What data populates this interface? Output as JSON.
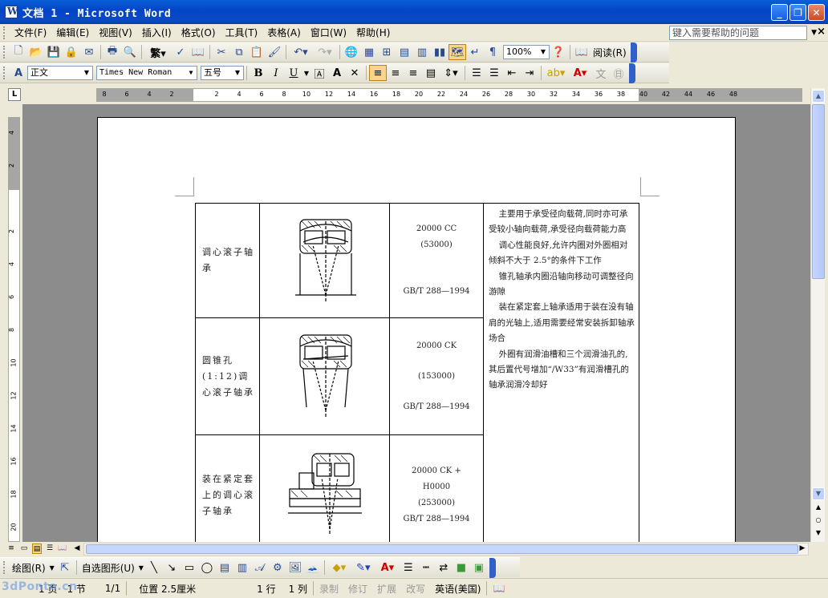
{
  "window": {
    "title": "文档 1 - Microsoft Word"
  },
  "menu": {
    "items": [
      "文件(F)",
      "编辑(E)",
      "视图(V)",
      "插入(I)",
      "格式(O)",
      "工具(T)",
      "表格(A)",
      "窗口(W)",
      "帮助(H)"
    ],
    "help_placeholder": "键入需要帮助的问题"
  },
  "standard_toolbar": {
    "zoom": "100%",
    "read_label": "阅读(R)"
  },
  "formatting_toolbar": {
    "style": "正文",
    "font": "Times New Roman",
    "size": "五号"
  },
  "ruler": {
    "h_ticks": [
      "8",
      "6",
      "4",
      "2",
      "2",
      "4",
      "6",
      "8",
      "10",
      "12",
      "14",
      "16",
      "18",
      "20",
      "22",
      "24",
      "26",
      "28",
      "30",
      "32",
      "34",
      "36",
      "38",
      "40",
      "42",
      "44",
      "46",
      "48"
    ],
    "v_ticks": [
      "4",
      "2",
      "2",
      "4",
      "6",
      "8",
      "10",
      "12",
      "14",
      "16",
      "18",
      "20"
    ]
  },
  "table": {
    "rows": [
      {
        "name": "调心滚子轴承",
        "code": "20000 CC",
        "code2": "(53000)",
        "standard": "GB/T 288—1994"
      },
      {
        "name": "圆锥孔(1:12)调心滚子轴承",
        "code": "20000 CK",
        "code2": "(153000)",
        "standard": "GB/T 288—1994"
      },
      {
        "name": "装在紧定套上的调心滚子轴承",
        "code": "20000 CK +",
        "code1b": "H0000",
        "code2": "(253000)",
        "standard": "GB/T 288—1994"
      }
    ],
    "description": [
      "主要用于承受径向载荷,同时亦可承受较小轴向载荷,承受径向载荷能力高",
      "调心性能良好,允许内圈对外圈相对倾斜不大于 2.5°的条件下工作",
      "锥孔轴承内圈沿轴向移动可调整径向游隙",
      "装在紧定套上轴承适用于装在没有轴肩的光轴上,适用需要经常安装拆卸轴承场合",
      "外圈有润滑油槽和三个润滑油孔的,其后置代号增加“/W33”有润滑槽孔的轴承润滑冷却好"
    ]
  },
  "drawing_toolbar": {
    "draw_label": "绘图(R)",
    "autoshapes_label": "自选图形(U)"
  },
  "status": {
    "page": "1 页",
    "section": "1 节",
    "pages": "1/1",
    "position": "位置 2.5厘米",
    "line": "1 行",
    "column": "1 列",
    "rec": "录制",
    "trk": "修订",
    "ext": "扩展",
    "ovr": "改写",
    "language": "英语(美国)"
  },
  "watermark": "3dPonto.cn",
  "colors": {
    "titlebar": "#0a48c6",
    "chrome": "#ece9d8",
    "workspace": "#8c8c8c",
    "selected_button": "#f9d48b"
  }
}
